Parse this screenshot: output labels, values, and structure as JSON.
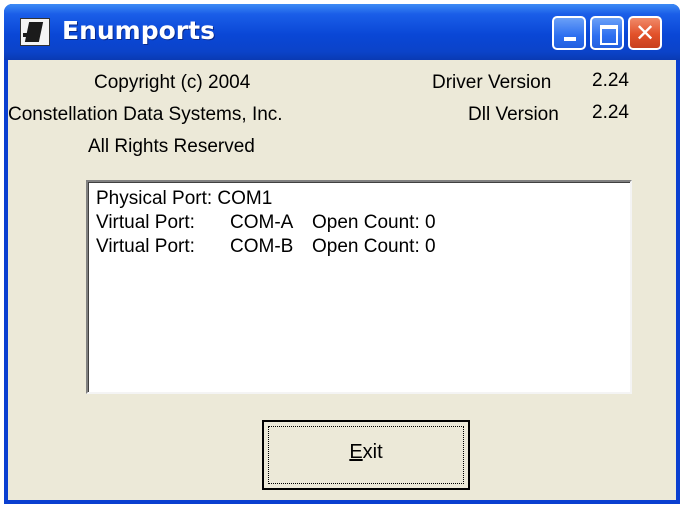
{
  "window": {
    "title": "Enumports",
    "icon": "app-icon",
    "controls": [
      "minimize-icon",
      "maximize-icon",
      "close-icon"
    ]
  },
  "info": {
    "copyright": "Copyright (c) 2004",
    "company": "Constellation Data Systems, Inc.",
    "rights": "All Rights Reserved",
    "driver_label": "Driver Version",
    "driver_value": "2.24",
    "dll_label": "Dll Version",
    "dll_value": "2.24"
  },
  "ports": {
    "rows": [
      {
        "label": "Physical Port: COM1",
        "port": "",
        "count": ""
      },
      {
        "label": "Virtual Port:",
        "port": "COM-A",
        "count": "Open Count: 0"
      },
      {
        "label": "Virtual Port:",
        "port": "COM-B",
        "count": "Open Count: 0"
      }
    ]
  },
  "buttons": {
    "exit_mnemonic": "E",
    "exit_rest": "xit"
  },
  "colors": {
    "titlebar": "#0a47d6",
    "client": "#ece9d8",
    "close": "#e2512a"
  }
}
